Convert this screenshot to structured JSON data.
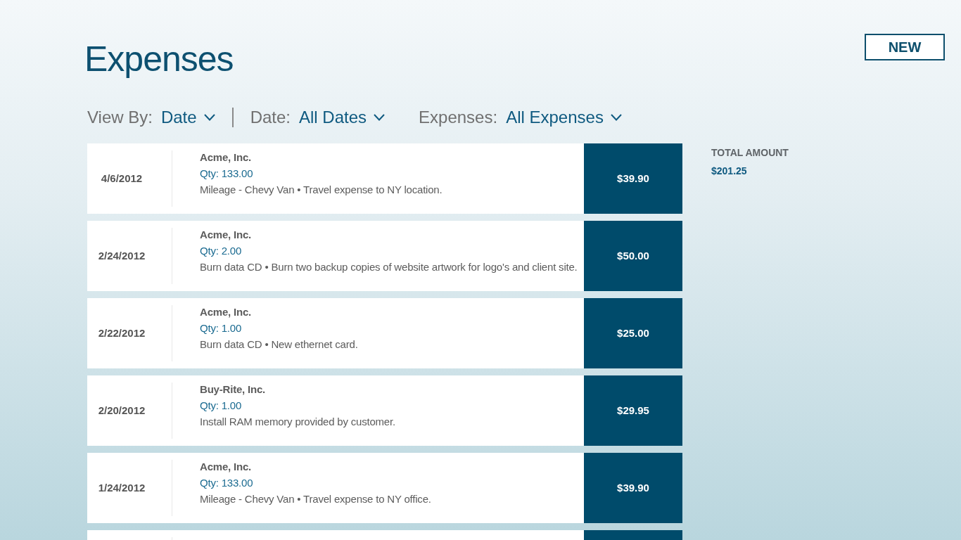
{
  "header": {
    "title": "Expenses",
    "new_button": "NEW"
  },
  "filters": [
    {
      "label": "View By:",
      "value": "Date",
      "separator_after": true
    },
    {
      "label": "Date:",
      "value": "All Dates",
      "separator_after": false
    },
    {
      "label": "Expenses:",
      "value": "All Expenses",
      "separator_after": false
    }
  ],
  "expenses": {
    "rows": [
      {
        "date": "4/6/2012",
        "vendor": "Acme, Inc.",
        "qty": "Qty: 133.00",
        "description": "Mileage - Chevy Van • Travel expense to NY location.",
        "amount": "$39.90"
      },
      {
        "date": "2/24/2012",
        "vendor": "Acme, Inc.",
        "qty": "Qty: 2.00",
        "description": "Burn data CD • Burn two backup copies of website artwork for logo's and client site.",
        "amount": "$50.00"
      },
      {
        "date": "2/22/2012",
        "vendor": "Acme, Inc.",
        "qty": "Qty: 1.00",
        "description": "Burn data CD • New ethernet card.",
        "amount": "$25.00"
      },
      {
        "date": "2/20/2012",
        "vendor": "Buy-Rite, Inc.",
        "qty": "Qty: 1.00",
        "description": "Install RAM memory provided by customer.",
        "amount": "$29.95"
      },
      {
        "date": "1/24/2012",
        "vendor": "Acme, Inc.",
        "qty": "Qty: 133.00",
        "description": "Mileage - Chevy Van • Travel expense to NY office.",
        "amount": "$39.90"
      }
    ],
    "more_below": true
  },
  "summary": {
    "label": "TOTAL AMOUNT",
    "amount": "$201.25"
  }
}
